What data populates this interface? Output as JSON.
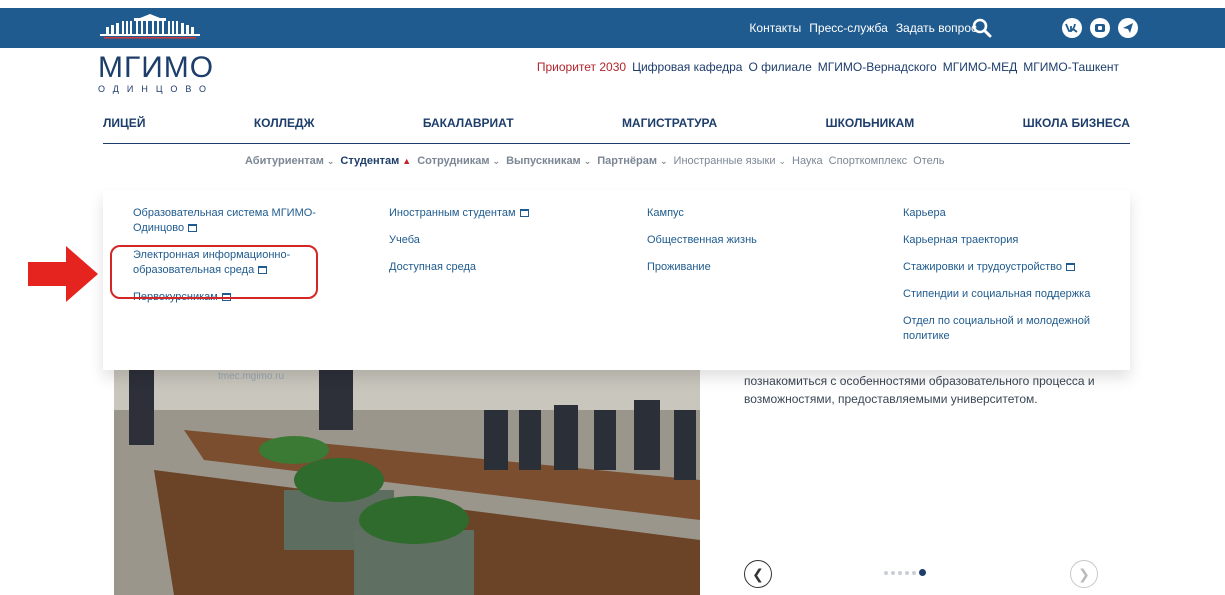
{
  "topbar": {
    "links": [
      "Контакты",
      "Пресс-служба",
      "Задать вопрос"
    ],
    "social": [
      "vk-icon",
      "rutube-icon",
      "telegram-icon"
    ]
  },
  "brand": {
    "name": "МГИМО",
    "city": "ОДИНЦОВО"
  },
  "secondary_links": [
    "Приоритет 2030",
    "Цифровая кафедра",
    "О филиале",
    "МГИМО-Вернадского",
    "МГИМО-МЕД",
    "МГИМО-Ташкент"
  ],
  "main_nav": [
    "ЛИЦЕЙ",
    "КОЛЛЕДЖ",
    "БАКАЛАВРИАТ",
    "МАГИСТРАТУРА",
    "ШКОЛЬНИКАМ",
    "ШКОЛА БИЗНЕСА"
  ],
  "sub_nav": [
    {
      "label": "Абитуриентам",
      "dropdown": true
    },
    {
      "label": "Студентам",
      "dropdown": true,
      "active": true
    },
    {
      "label": "Сотрудникам",
      "dropdown": true
    },
    {
      "label": "Выпускникам",
      "dropdown": true
    },
    {
      "label": "Партнёрам",
      "dropdown": true
    },
    {
      "label": "Иностранные языки",
      "dropdown": true
    },
    {
      "label": "Наука"
    },
    {
      "label": "Спорткомплекс"
    },
    {
      "label": "Отель"
    }
  ],
  "mega_menu": {
    "col1": {
      "item1": "Образовательная система МГИМО-Одинцово",
      "item2": "Электронная информационно-образовательная среда",
      "item3": "Первокурсникам"
    },
    "col2": {
      "item1": "Иностранным студентам",
      "item2": "Учеба",
      "item3": "Доступная среда"
    },
    "col3": {
      "item1": "Кампус",
      "item2": "Общественная жизнь",
      "item3": "Проживание"
    },
    "col4": {
      "item1": "Карьера",
      "item2": "Карьерная траектория",
      "item3": "Стажировки и трудоустройство",
      "item4": "Стипендии и социальная поддержка",
      "item5": "Отдел по социальной и молодежной политике"
    }
  },
  "content": {
    "description": "познакомиться с особенностями образовательного процесса и возможностями, предоставляемыми университетом.",
    "photo_caption": "tmec.mgimo.ru"
  },
  "slider": {
    "total": 6,
    "active": 6
  },
  "colors": {
    "topbar": "#1f5b8e",
    "brand": "#1d3d6b",
    "accent_red": "#b2242d",
    "highlight": "#d42626"
  }
}
